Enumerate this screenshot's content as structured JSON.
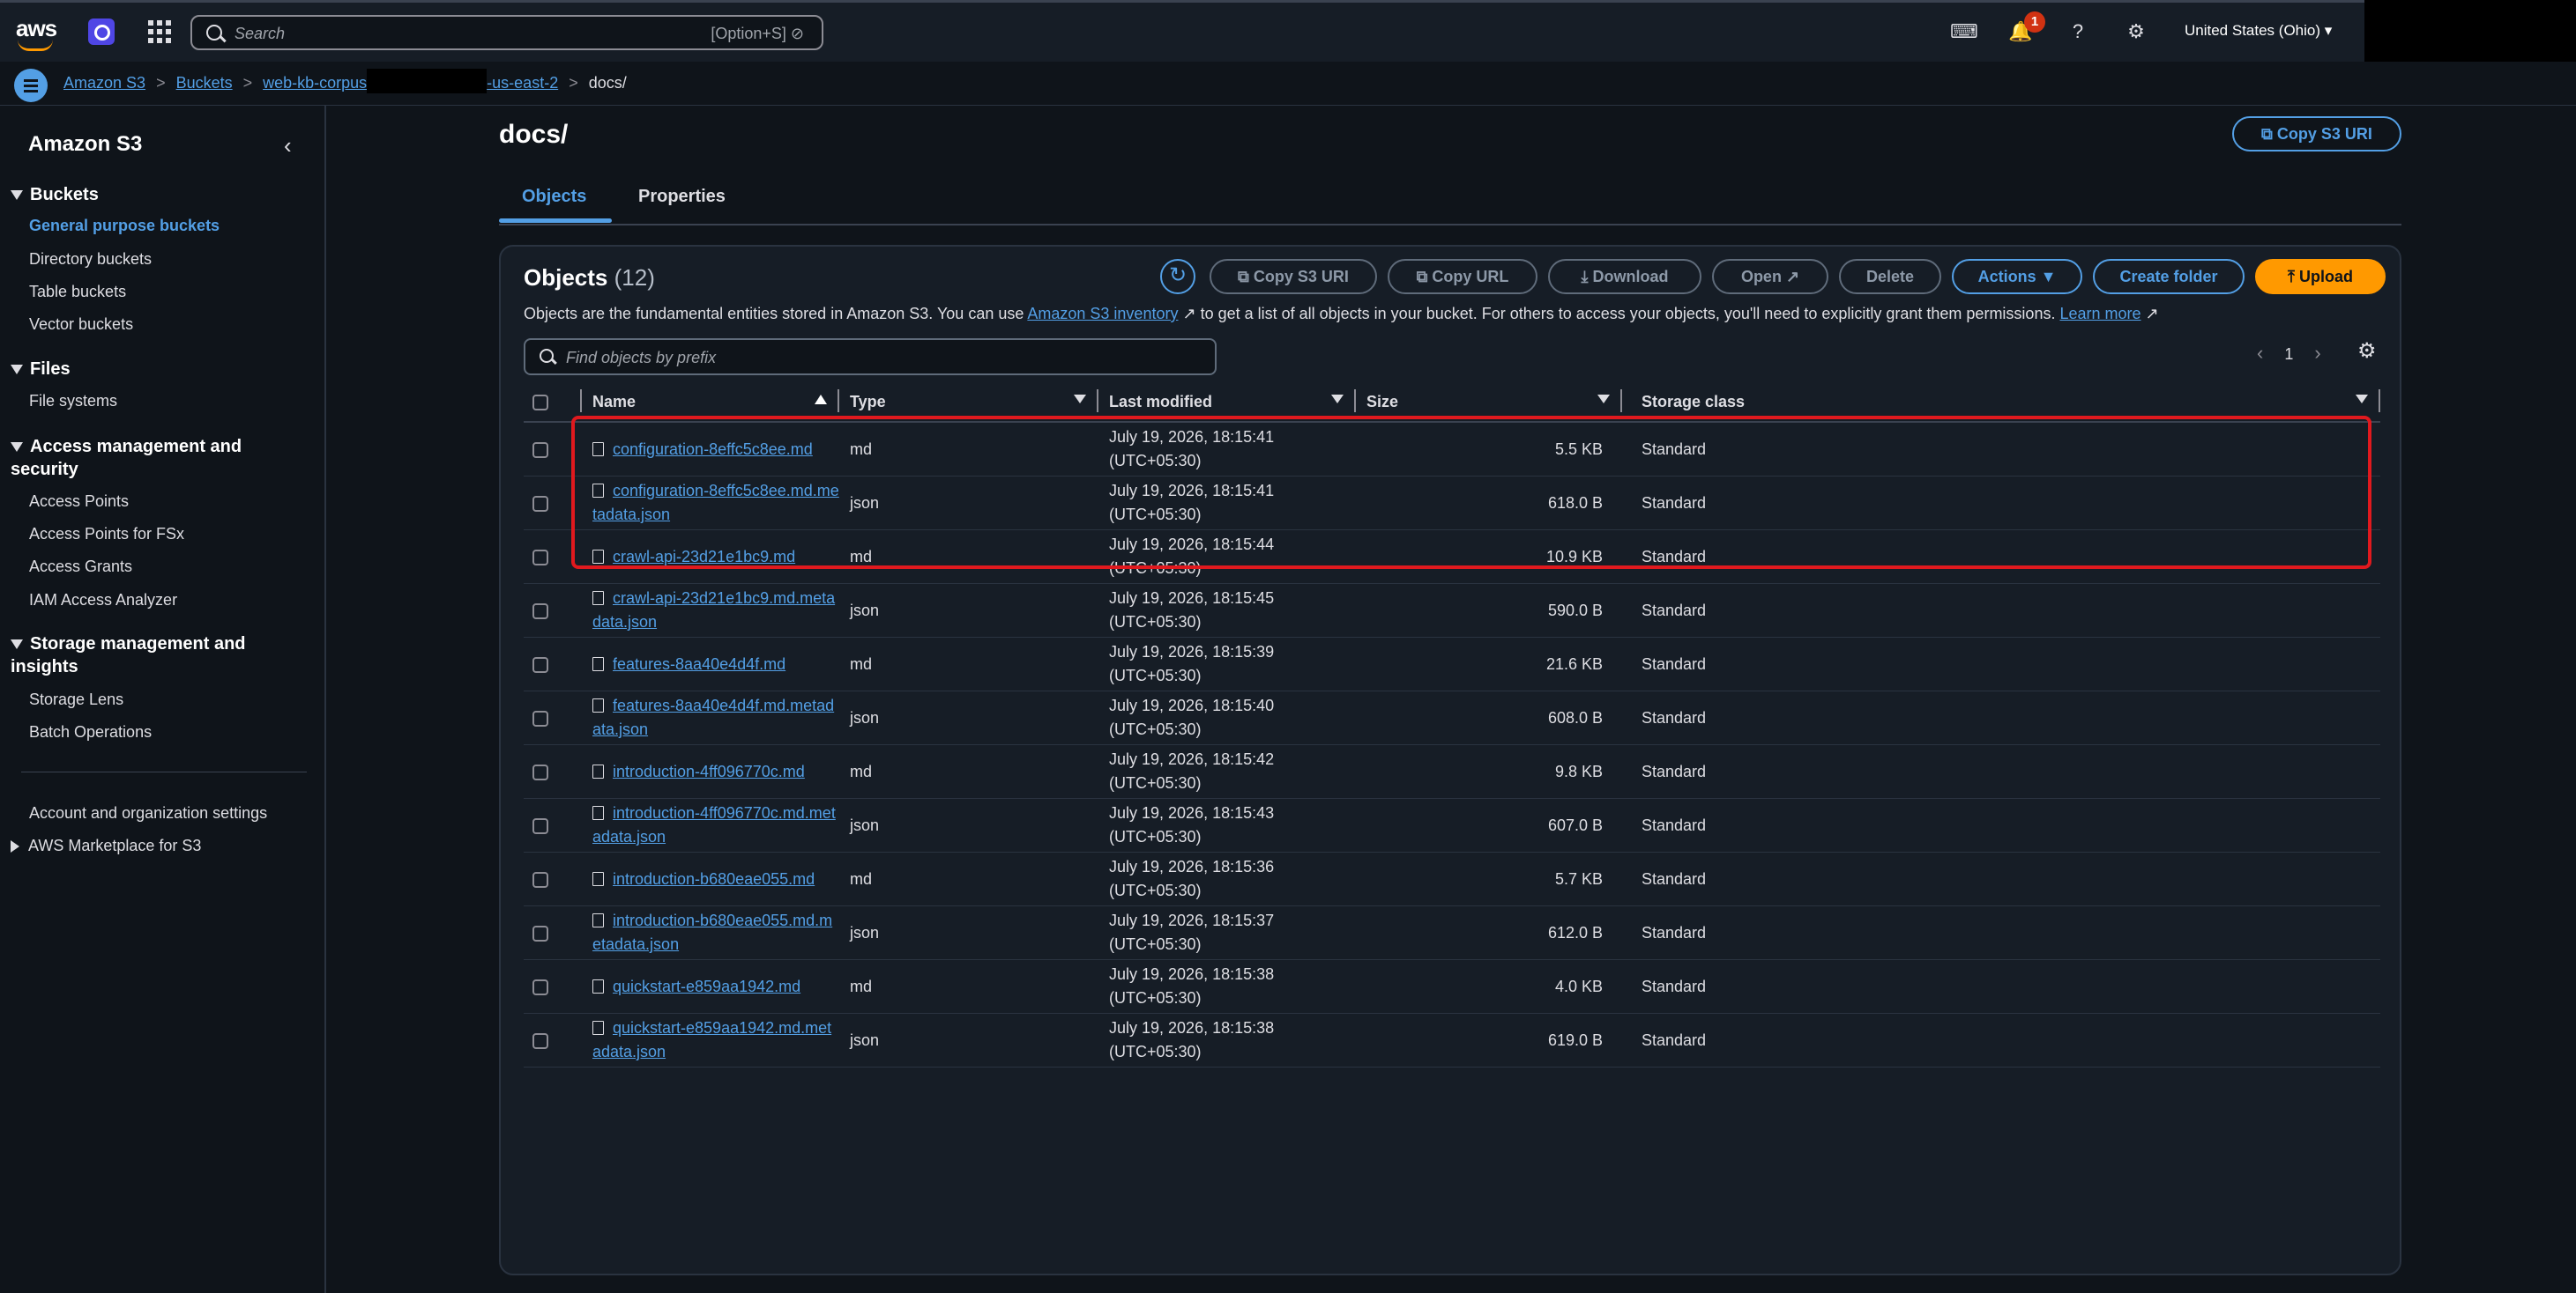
{
  "topnav": {
    "search_placeholder": "Search",
    "search_shortcut": "[Option+S]",
    "notification_count": "1",
    "region": "United States (Ohio)"
  },
  "breadcrumb": {
    "items": [
      "Amazon S3",
      "Buckets",
      "web-kb-corpus",
      "-us-east-2"
    ],
    "current": "docs/"
  },
  "sidebar": {
    "title": "Amazon S3",
    "sections": [
      {
        "title": "Buckets",
        "items": [
          "General purpose buckets",
          "Directory buckets",
          "Table buckets",
          "Vector buckets"
        ]
      },
      {
        "title": "Files",
        "items": [
          "File systems"
        ]
      },
      {
        "title": "Access management and security",
        "items": [
          "Access Points",
          "Access Points for FSx",
          "Access Grants",
          "IAM Access Analyzer"
        ]
      },
      {
        "title": "Storage management and insights",
        "items": [
          "Storage Lens",
          "Batch Operations"
        ]
      }
    ],
    "footer_items": [
      "Account and organization settings",
      "AWS Marketplace for S3"
    ]
  },
  "page": {
    "title": "docs/",
    "copy_s3_uri": "Copy S3 URI",
    "tabs": [
      "Objects",
      "Properties"
    ]
  },
  "objects": {
    "heading": "Objects",
    "count": "(12)",
    "buttons": {
      "copy_s3_uri": "Copy S3 URI",
      "copy_url": "Copy URL",
      "download": "Download",
      "open": "Open",
      "delete": "Delete",
      "actions": "Actions",
      "create_folder": "Create folder",
      "upload": "Upload"
    },
    "description_pre": "Objects are the fundamental entities stored in Amazon S3. You can use ",
    "description_link": "Amazon S3 inventory",
    "description_post": " to get a list of all objects in your bucket. For others to access your objects, you'll need to explicitly grant them permissions. ",
    "learn_more": "Learn more",
    "filter_placeholder": "Find objects by prefix",
    "page_number": "1",
    "columns": [
      "Name",
      "Type",
      "Last modified",
      "Size",
      "Storage class"
    ],
    "rows": [
      {
        "name": "configuration-8effc5c8ee.md",
        "type": "md",
        "date": "July 19, 2026, 18:15:41",
        "tz": "(UTC+05:30)",
        "size": "5.5 KB",
        "class": "Standard"
      },
      {
        "name": "configuration-8effc5c8ee.md.metadata.json",
        "type": "json",
        "date": "July 19, 2026, 18:15:41",
        "tz": "(UTC+05:30)",
        "size": "618.0 B",
        "class": "Standard"
      },
      {
        "name": "crawl-api-23d21e1bc9.md",
        "type": "md",
        "date": "July 19, 2026, 18:15:44",
        "tz": "(UTC+05:30)",
        "size": "10.9 KB",
        "class": "Standard"
      },
      {
        "name": "crawl-api-23d21e1bc9.md.metadata.json",
        "type": "json",
        "date": "July 19, 2026, 18:15:45",
        "tz": "(UTC+05:30)",
        "size": "590.0 B",
        "class": "Standard"
      },
      {
        "name": "features-8aa40e4d4f.md",
        "type": "md",
        "date": "July 19, 2026, 18:15:39",
        "tz": "(UTC+05:30)",
        "size": "21.6 KB",
        "class": "Standard"
      },
      {
        "name": "features-8aa40e4d4f.md.metadata.json",
        "type": "json",
        "date": "July 19, 2026, 18:15:40",
        "tz": "(UTC+05:30)",
        "size": "608.0 B",
        "class": "Standard"
      },
      {
        "name": "introduction-4ff096770c.md",
        "type": "md",
        "date": "July 19, 2026, 18:15:42",
        "tz": "(UTC+05:30)",
        "size": "9.8 KB",
        "class": "Standard"
      },
      {
        "name": "introduction-4ff096770c.md.metadata.json",
        "type": "json",
        "date": "July 19, 2026, 18:15:43",
        "tz": "(UTC+05:30)",
        "size": "607.0 B",
        "class": "Standard"
      },
      {
        "name": "introduction-b680eae055.md",
        "type": "md",
        "date": "July 19, 2026, 18:15:36",
        "tz": "(UTC+05:30)",
        "size": "5.7 KB",
        "class": "Standard"
      },
      {
        "name": "introduction-b680eae055.md.metadata.json",
        "type": "json",
        "date": "July 19, 2026, 18:15:37",
        "tz": "(UTC+05:30)",
        "size": "612.0 B",
        "class": "Standard"
      },
      {
        "name": "quickstart-e859aa1942.md",
        "type": "md",
        "date": "July 19, 2026, 18:15:38",
        "tz": "(UTC+05:30)",
        "size": "4.0 KB",
        "class": "Standard"
      },
      {
        "name": "quickstart-e859aa1942.md.metadata.json",
        "type": "json",
        "date": "July 19, 2026, 18:15:38",
        "tz": "(UTC+05:30)",
        "size": "619.0 B",
        "class": "Standard"
      }
    ]
  },
  "colors": {
    "accent": "#539fe5",
    "upload": "#ff9900",
    "highlight": "#e0191e",
    "background": "#0f141a",
    "panel": "#161d26"
  }
}
